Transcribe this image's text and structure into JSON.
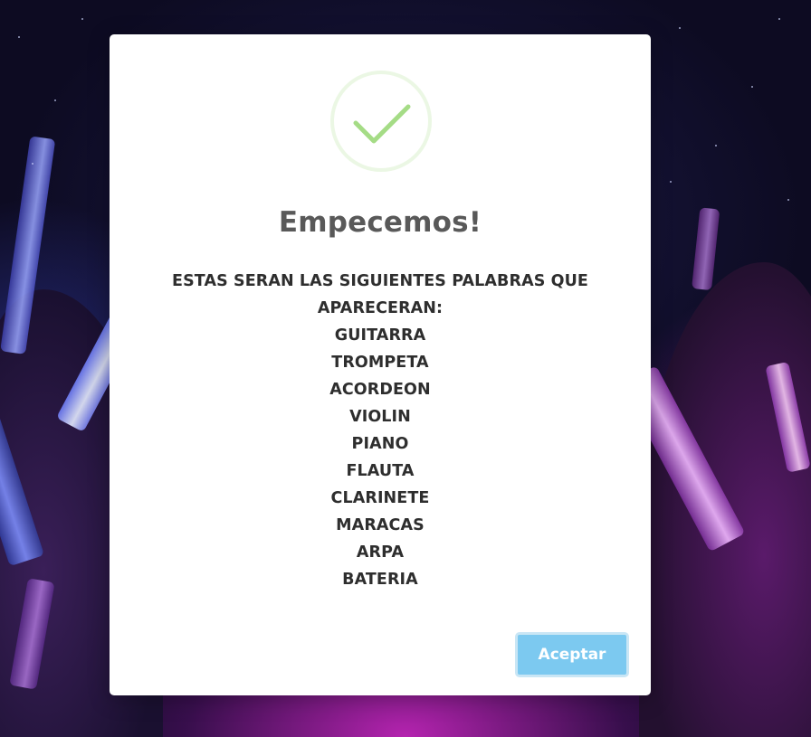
{
  "modal": {
    "icon": "success-check-icon",
    "title": "Empecemos!",
    "intro": "ESTAS SERAN LAS SIGUIENTES PALABRAS QUE APARECERAN:",
    "words": [
      "GUITARRA",
      "TROMPETA",
      "ACORDEON",
      "VIOLIN",
      "PIANO",
      "FLAUTA",
      "CLARINETE",
      "MARACAS",
      "ARPA",
      "BATERIA"
    ],
    "confirm_label": "Aceptar"
  },
  "colors": {
    "check_green": "#a5dc86",
    "confirm_button": "#7cc9f0",
    "title_text": "#595959"
  }
}
